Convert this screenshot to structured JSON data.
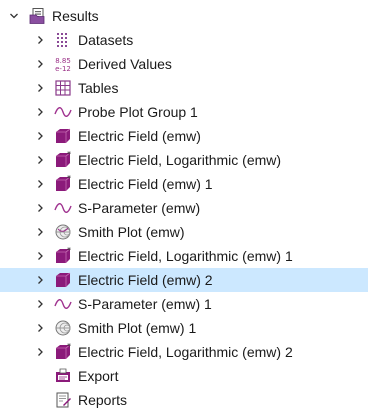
{
  "tree": {
    "root": {
      "label": "Results",
      "icon": "results-folder-icon",
      "expanded": true
    },
    "items": [
      {
        "label": "Datasets",
        "icon": "datasets-icon"
      },
      {
        "label": "Derived Values",
        "icon": "derived-values-icon",
        "icon_text_top": "8.85",
        "icon_text_bottom": "e-12"
      },
      {
        "label": "Tables",
        "icon": "table-grid-icon"
      },
      {
        "label": "Probe Plot Group 1",
        "icon": "wave-icon"
      },
      {
        "label": "Electric Field (emw)",
        "icon": "3d-plot-cube-icon"
      },
      {
        "label": "Electric Field, Logarithmic (emw)",
        "icon": "3d-plot-cube-star-icon"
      },
      {
        "label": "Electric Field (emw) 1",
        "icon": "3d-plot-cube-star-icon"
      },
      {
        "label": "S-Parameter (emw)",
        "icon": "wave-icon"
      },
      {
        "label": "Smith Plot (emw)",
        "icon": "smith-chart-icon"
      },
      {
        "label": "Electric Field, Logarithmic (emw) 1",
        "icon": "3d-plot-cube-star-icon"
      },
      {
        "label": "Electric Field (emw) 2",
        "icon": "3d-plot-cube-icon",
        "selected": true
      },
      {
        "label": "S-Parameter (emw) 1",
        "icon": "wave-icon"
      },
      {
        "label": "Smith Plot (emw) 1",
        "icon": "smith-chart-icon"
      },
      {
        "label": "Electric Field, Logarithmic (emw) 2",
        "icon": "3d-plot-cube-star-icon"
      }
    ],
    "leaves": [
      {
        "label": "Export",
        "icon": "export-icon"
      },
      {
        "label": "Reports",
        "icon": "reports-icon"
      }
    ]
  },
  "colors": {
    "selection": "#cce8ff",
    "plot_purple": "#8b1a7a",
    "wave_purple": "#a03490",
    "datasets_purple": "#7a3a86"
  }
}
